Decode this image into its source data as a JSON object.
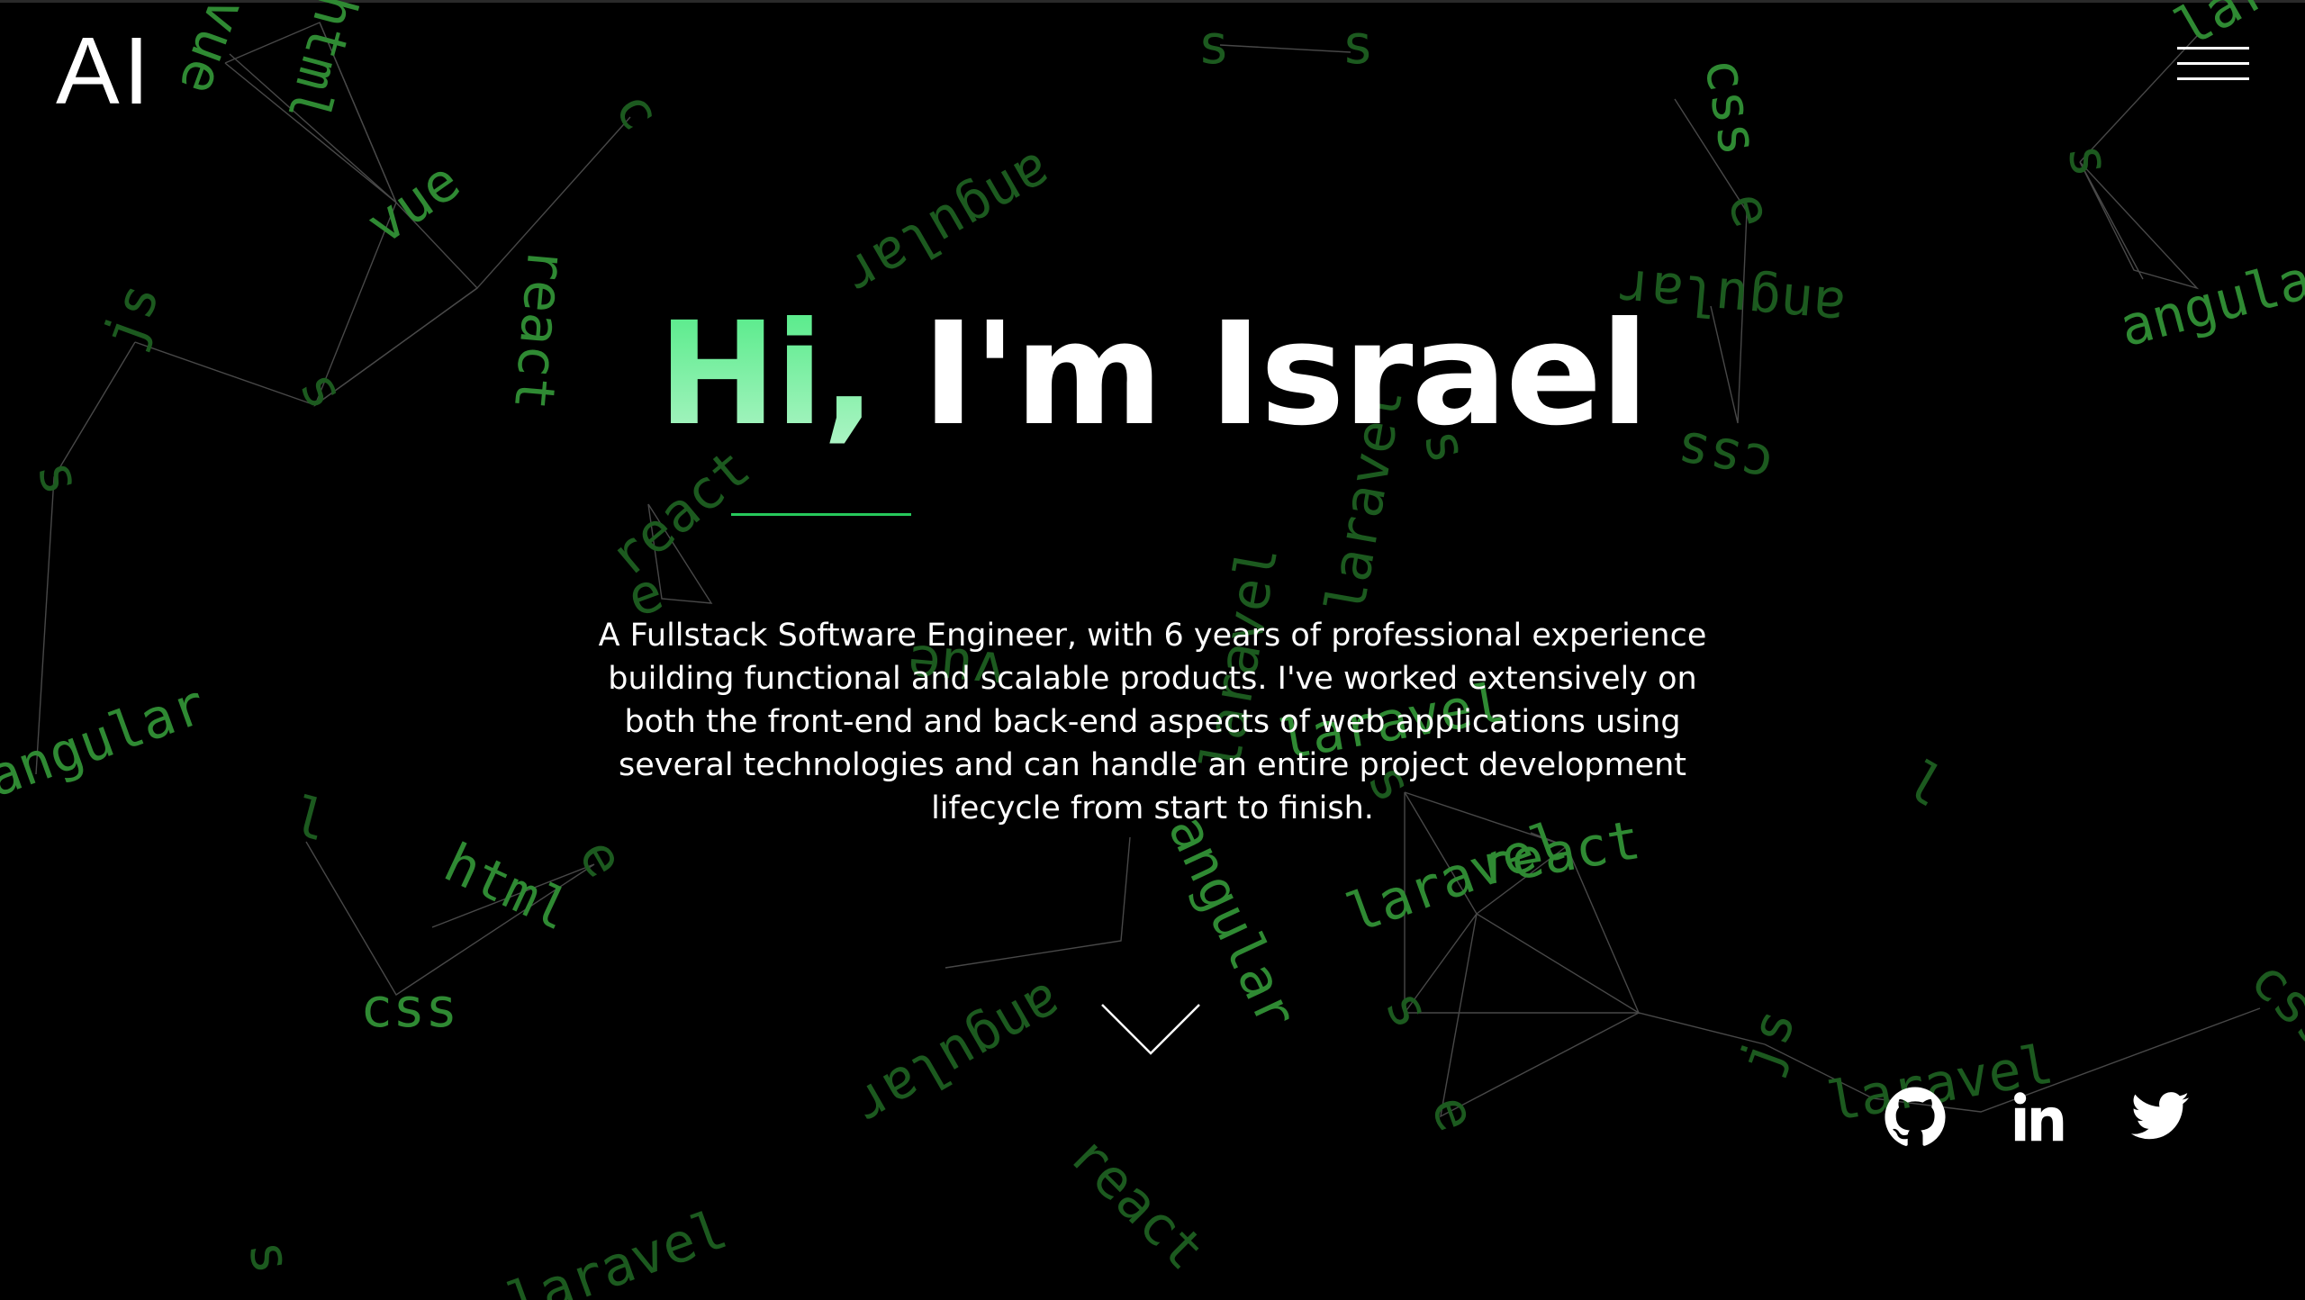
{
  "brand": {
    "logo_text": "AI"
  },
  "nav": {
    "menu_icon": "hamburger-menu-icon"
  },
  "hero": {
    "greeting": "Hi,",
    "name": "I'm Israel",
    "greeting_color": "#4dea83",
    "intro": "A Fullstack Software Engineer, with 6 years of professional experience building functional and scalable products. I've worked extensively on both the front-end and back-end aspects of web applications using several technologies and can handle an entire project development lifecycle from start to finish."
  },
  "scroll_indicator": {
    "icon": "chevron-down-icon"
  },
  "social": [
    {
      "name": "github",
      "icon": "github-icon"
    },
    {
      "name": "linkedin",
      "icon": "linkedin-icon"
    },
    {
      "name": "twitter",
      "icon": "twitter-icon"
    }
  ],
  "background": {
    "floating_words": [
      "vue",
      "html",
      "s",
      "css",
      "c",
      "angular",
      "react",
      "js",
      "e",
      "laravel",
      "l"
    ],
    "word_color": "#1c5a1f"
  }
}
